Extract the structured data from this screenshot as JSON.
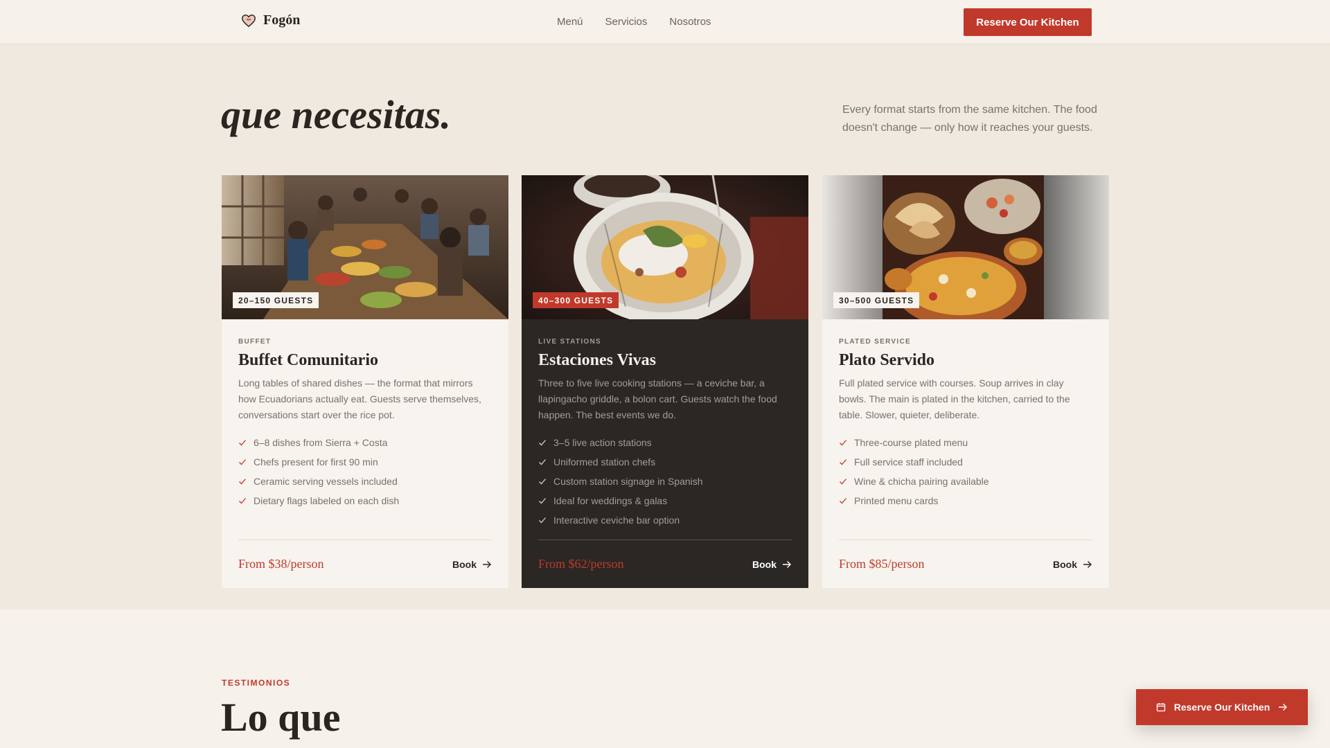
{
  "header": {
    "brand": "Fogón",
    "nav": [
      "Menú",
      "Servicios",
      "Nosotros"
    ],
    "cta": "Reserve Our Kitchen"
  },
  "hero": {
    "title": "que necesitas.",
    "description": "Every format starts from the same kitchen. The food doesn't change — only how it reaches your guests."
  },
  "cards": [
    {
      "badge": "20–150 GUESTS",
      "kicker": "BUFFET",
      "title": "Buffet Comunitario",
      "description": "Long tables of shared dishes — the format that mirrors how Ecuadorians actually eat. Guests serve themselves, conversations start over the rice pot.",
      "features": [
        "6–8 dishes from Sierra + Costa",
        "Chefs present for first 90 min",
        "Ceramic serving vessels included",
        "Dietary flags labeled on each dish"
      ],
      "price": "From $38/person",
      "book": "Book"
    },
    {
      "badge": "40–300 GUESTS",
      "kicker": "LIVE STATIONS",
      "title": "Estaciones Vivas",
      "description": "Three to five live cooking stations — a ceviche bar, a llapingacho griddle, a bolon cart. Guests watch the food happen. The best events we do.",
      "features": [
        "3–5 live action stations",
        "Uniformed station chefs",
        "Custom station signage in Spanish",
        "Ideal for weddings & galas",
        "Interactive ceviche bar option"
      ],
      "price": "From $62/person",
      "book": "Book"
    },
    {
      "badge": "30–500 GUESTS",
      "kicker": "PLATED SERVICE",
      "title": "Plato Servido",
      "description": "Full plated service with courses. Soup arrives in clay bowls. The main is plated in the kitchen, carried to the table. Slower, quieter, deliberate.",
      "features": [
        "Three-course plated menu",
        "Full service staff included",
        "Wine & chicha pairing available",
        "Printed menu cards"
      ],
      "price": "From $85/person",
      "book": "Book"
    }
  ],
  "testimonials": {
    "kicker": "TESTIMONIOS",
    "title": "Lo que"
  },
  "floating_cta": "Reserve Our Kitchen",
  "colors": {
    "accent": "#c0392b",
    "background": "#efe9e0",
    "dark_card": "#2b2724"
  },
  "icons": [
    "heart-logo-icon",
    "check-icon",
    "arrow-right-icon",
    "calendar-icon"
  ]
}
